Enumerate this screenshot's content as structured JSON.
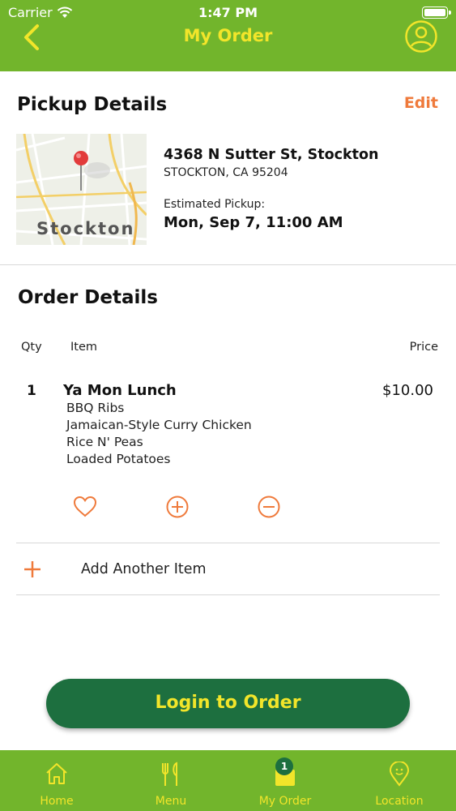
{
  "status_bar": {
    "carrier": "Carrier",
    "time": "1:47 PM"
  },
  "header": {
    "title": "My Order"
  },
  "pickup": {
    "title": "Pickup Details",
    "edit_label": "Edit",
    "map_label": "Stockton",
    "address_line1": "4368 N Sutter St, Stockton",
    "address_line2": "STOCKTON, CA 95204",
    "estimated_label": "Estimated Pickup:",
    "estimated_value": "Mon, Sep 7, 11:00 AM"
  },
  "order": {
    "title": "Order Details",
    "columns": {
      "qty": "Qty",
      "item": "Item",
      "price": "Price"
    },
    "items": [
      {
        "qty": "1",
        "name": "Ya Mon Lunch",
        "price": "$10.00",
        "modifiers": [
          "BBQ Ribs",
          "Jamaican-Style Curry Chicken",
          "Rice N' Peas",
          "Loaded Potatoes"
        ]
      }
    ],
    "add_item_label": "Add Another Item"
  },
  "login_button": {
    "label": "Login to Order"
  },
  "tabbar": {
    "tabs": [
      {
        "label": "Home",
        "icon": "home-icon"
      },
      {
        "label": "Menu",
        "icon": "fork-knife-icon"
      },
      {
        "label": "My Order",
        "icon": "bag-icon",
        "badge": "1"
      },
      {
        "label": "Location",
        "icon": "location-pin-icon"
      }
    ]
  },
  "colors": {
    "header_green": "#72b52c",
    "title_yellow": "#f2e52a",
    "accent_orange": "#ef7a3b",
    "button_dark_green": "#1d6f3f"
  }
}
